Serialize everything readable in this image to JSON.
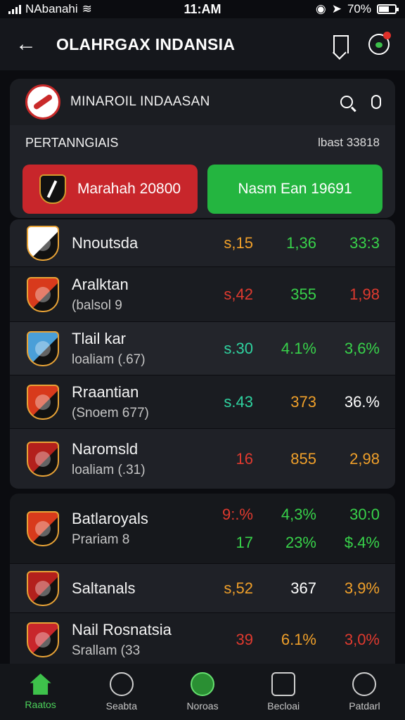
{
  "status": {
    "carrier": "NAbanahi",
    "time": "11:AM",
    "battery": "70%"
  },
  "header": {
    "title": "OLAHRGAX INDANSIA"
  },
  "card": {
    "title": "MINAROIL INDAASAN",
    "section_label": "PERTANNGIAIS",
    "section_right": "lbast 33818",
    "btn_red": "Marahah 20800",
    "btn_green": "Nasm Ean 19691"
  },
  "colors": {
    "red": "#e03a2f",
    "orange": "#f0a02a",
    "green": "#38d24a",
    "teal": "#2fd3a0",
    "white": "#ffffff"
  },
  "teams": [
    {
      "name": "Nnoutsda",
      "sub": "",
      "crest": "#ffffff",
      "vals": [
        {
          "t": "s,15",
          "c": "#f0a02a"
        },
        {
          "t": "1,36",
          "c": "#38d24a"
        },
        {
          "t": "33:3",
          "c": "#38d24a"
        }
      ]
    },
    {
      "name": "Aralktan",
      "sub": "(balsol 9",
      "crest": "#d83a1c",
      "vals": [
        {
          "t": "s,42",
          "c": "#e03a2f"
        },
        {
          "t": "355",
          "c": "#38d24a"
        },
        {
          "t": "1,98",
          "c": "#e03a2f"
        }
      ]
    },
    {
      "name": "Tlail kar",
      "sub": "loaliam (.67)",
      "crest": "#4a9fd8",
      "vals": [
        {
          "t": "s.30",
          "c": "#2fd3a0"
        },
        {
          "t": "4.1%",
          "c": "#38d24a"
        },
        {
          "t": "3,6%",
          "c": "#38d24a"
        }
      ]
    },
    {
      "name": "Rraantian",
      "sub": "(Snoem 677)",
      "crest": "#d83a1c",
      "vals": [
        {
          "t": "s.43",
          "c": "#2fd3a0"
        },
        {
          "t": "373",
          "c": "#f0a02a"
        },
        {
          "t": "36.%",
          "c": "#ffffff"
        }
      ]
    },
    {
      "name": "Naromsld",
      "sub": "loaliam (.31)",
      "crest": "#b3201c",
      "vals": [
        {
          "t": "16",
          "c": "#e03a2f"
        },
        {
          "t": "855",
          "c": "#f0a02a"
        },
        {
          "t": "2,98",
          "c": "#f0a02a"
        }
      ]
    },
    {
      "name": "Batlaroyals",
      "sub": "Prariam 8",
      "crest": "#d83a1c",
      "vals": [
        {
          "t": "9:.%",
          "c": "#e03a2f"
        },
        {
          "t": "4,3%",
          "c": "#38d24a"
        },
        {
          "t": "30:0",
          "c": "#38d24a"
        }
      ],
      "vals2": [
        {
          "t": "17",
          "c": "#38d24a"
        },
        {
          "t": "23%",
          "c": "#38d24a"
        },
        {
          "t": "$.4%",
          "c": "#38d24a"
        }
      ]
    },
    {
      "name": "Saltanals",
      "sub": "",
      "crest": "#b3201c",
      "vals": [
        {
          "t": "s,52",
          "c": "#f0a02a"
        },
        {
          "t": "367",
          "c": "#ffffff"
        },
        {
          "t": "3,9%",
          "c": "#f0a02a"
        }
      ]
    },
    {
      "name": "Nail Rosnatsia",
      "sub": "Srallam (33",
      "crest": "#c8262b",
      "vals": [
        {
          "t": "39",
          "c": "#e03a2f"
        },
        {
          "t": "6.1%",
          "c": "#f0a02a"
        },
        {
          "t": "3,0%",
          "c": "#e03a2f"
        }
      ]
    }
  ],
  "nav": [
    {
      "label": "Raatos",
      "icon": "home-icon",
      "active": true
    },
    {
      "label": "Seabta",
      "icon": "clock-icon",
      "active": false
    },
    {
      "label": "Noroas",
      "icon": "news-icon",
      "active": false
    },
    {
      "label": "Becloai",
      "icon": "square-icon",
      "active": false
    },
    {
      "label": "Patdarl",
      "icon": "target-icon",
      "active": false
    }
  ]
}
